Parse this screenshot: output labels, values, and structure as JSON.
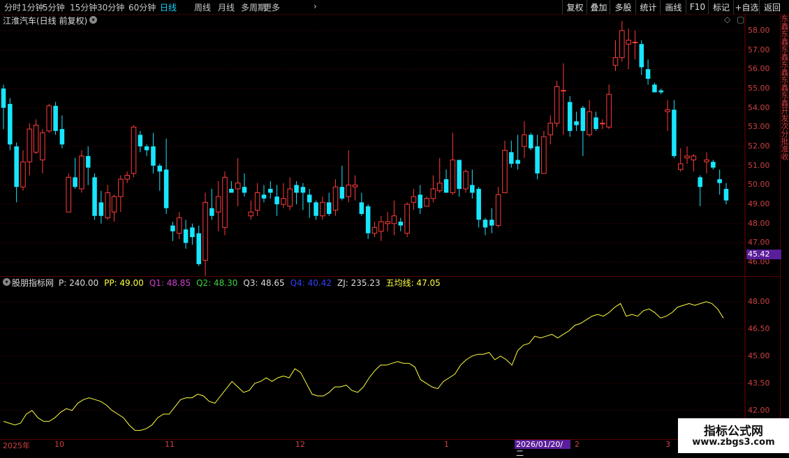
{
  "toolbar": {
    "left": [
      "分时",
      "1分钟",
      "5分钟",
      "15分钟",
      "30分钟",
      "60分钟",
      "日线",
      "周线",
      "月线",
      "多周期",
      "更多"
    ],
    "active": "日线",
    "right": [
      "复权",
      "叠加",
      "多股",
      "统计",
      "画线",
      "F10",
      "标记",
      "+自选",
      "返回"
    ]
  },
  "title": {
    "stock": "江淮汽车(日线 前复权)"
  },
  "main_axis": {
    "labels": [
      "58.00",
      "57.00",
      "56.00",
      "55.00",
      "54.00",
      "53.00",
      "52.00",
      "51.00",
      "50.00",
      "49.00",
      "48.00",
      "47.00",
      "46.00"
    ],
    "current_price": "45.42"
  },
  "indicator": {
    "name": "股朋指标网",
    "items": [
      {
        "label": "P: 240.00",
        "color": "#dcdcdc"
      },
      {
        "label": "PP: 49.00",
        "color": "#ffff40"
      },
      {
        "label": "Q1: 48.85",
        "color": "#d040d0"
      },
      {
        "label": "Q2: 48.30",
        "color": "#40d040"
      },
      {
        "label": "Q3: 48.65",
        "color": "#dcdcdc"
      },
      {
        "label": "Q4: 40.42",
        "color": "#3040ff"
      },
      {
        "label": "ZJ: 235.23",
        "color": "#dcdcdc"
      },
      {
        "label": "五均线: 47.05",
        "color": "#ffff40"
      }
    ],
    "axis": [
      "48.00",
      "46.50",
      "45.00",
      "43.50",
      "42.00"
    ]
  },
  "dates": {
    "labels": [
      "2025年",
      "10",
      "11",
      "12",
      "1",
      "2",
      "3"
    ],
    "highlight": "2026/01/20/二"
  },
  "watermark": {
    "line1": "指标公式网",
    "line2": "www.zbgs3.com"
  },
  "side_text": "东鑫东鑫东鑫东鑫东鑫东鑫开发次分批准收",
  "chart_data": [
    {
      "type": "candlestick",
      "title": "江淮汽车(日线 前复权)",
      "ylim": [
        45.5,
        58.5
      ],
      "up_color": "#ff3c3c",
      "down_color": "#18e6ff",
      "series": [
        {
          "o": 55.0,
          "c": 54.0,
          "h": 55.2,
          "l": 52.9
        },
        {
          "o": 54.2,
          "c": 52.1,
          "h": 54.5,
          "l": 51.8
        },
        {
          "o": 52.0,
          "c": 49.9,
          "h": 52.2,
          "l": 49.1
        },
        {
          "o": 49.9,
          "c": 51.2,
          "h": 51.8,
          "l": 49.7
        },
        {
          "o": 51.2,
          "c": 52.9,
          "h": 53.2,
          "l": 50.5
        },
        {
          "o": 51.7,
          "c": 53.1,
          "h": 53.4,
          "l": 51.6
        },
        {
          "o": 51.3,
          "c": 52.7,
          "h": 52.9,
          "l": 50.6
        },
        {
          "o": 52.8,
          "c": 54.1,
          "h": 54.2,
          "l": 52.7
        },
        {
          "o": 54.1,
          "c": 52.8,
          "h": 54.3,
          "l": 52.6
        },
        {
          "o": 52.9,
          "c": 52.1,
          "h": 53.6,
          "l": 51.9
        },
        {
          "o": 48.6,
          "c": 50.4,
          "h": 50.6,
          "l": 48.6
        },
        {
          "o": 50.4,
          "c": 49.9,
          "h": 51.4,
          "l": 49.8
        },
        {
          "o": 49.8,
          "c": 51.5,
          "h": 51.8,
          "l": 49.6
        },
        {
          "o": 51.5,
          "c": 50.9,
          "h": 52.0,
          "l": 50.0
        },
        {
          "o": 50.4,
          "c": 48.4,
          "h": 50.6,
          "l": 48.2
        },
        {
          "o": 49.1,
          "c": 48.4,
          "h": 49.7,
          "l": 48.0
        },
        {
          "o": 48.3,
          "c": 49.6,
          "h": 50.0,
          "l": 48.2
        },
        {
          "o": 48.6,
          "c": 49.4,
          "h": 49.5,
          "l": 48.1
        },
        {
          "o": 49.4,
          "c": 50.3,
          "h": 50.5,
          "l": 48.6
        },
        {
          "o": 50.3,
          "c": 50.5,
          "h": 50.7,
          "l": 50.1
        },
        {
          "o": 50.6,
          "c": 53.0,
          "h": 53.1,
          "l": 50.4
        },
        {
          "o": 52.6,
          "c": 52.0,
          "h": 52.8,
          "l": 51.7
        },
        {
          "o": 52.0,
          "c": 51.8,
          "h": 52.1,
          "l": 51.5
        },
        {
          "o": 52.0,
          "c": 51.0,
          "h": 52.7,
          "l": 50.6
        },
        {
          "o": 51.0,
          "c": 50.7,
          "h": 51.1,
          "l": 49.7
        },
        {
          "o": 50.8,
          "c": 48.8,
          "h": 52.4,
          "l": 48.5
        },
        {
          "o": 47.9,
          "c": 47.6,
          "h": 48.1,
          "l": 47.1
        },
        {
          "o": 47.5,
          "c": 48.3,
          "h": 48.6,
          "l": 47.2
        },
        {
          "o": 47.7,
          "c": 47.0,
          "h": 48.2,
          "l": 46.7
        },
        {
          "o": 47.8,
          "c": 47.3,
          "h": 48.0,
          "l": 46.9
        },
        {
          "o": 47.5,
          "c": 45.9,
          "h": 47.9,
          "l": 45.8
        },
        {
          "o": 46.1,
          "c": 49.1,
          "h": 49.6,
          "l": 45.3
        },
        {
          "o": 48.8,
          "c": 48.4,
          "h": 49.8,
          "l": 48.2
        },
        {
          "o": 48.6,
          "c": 49.4,
          "h": 50.2,
          "l": 47.6
        },
        {
          "o": 47.8,
          "c": 50.4,
          "h": 50.7,
          "l": 47.4
        },
        {
          "o": 49.8,
          "c": 49.6,
          "h": 50.2,
          "l": 49.6
        },
        {
          "o": 49.8,
          "c": 50.1,
          "h": 51.4,
          "l": 48.9
        },
        {
          "o": 49.9,
          "c": 49.6,
          "h": 50.6,
          "l": 49.4
        },
        {
          "o": 48.4,
          "c": 48.6,
          "h": 49.2,
          "l": 48.2
        },
        {
          "o": 48.7,
          "c": 49.6,
          "h": 50.1,
          "l": 48.4
        },
        {
          "o": 49.5,
          "c": 49.3,
          "h": 50.0,
          "l": 49.1
        },
        {
          "o": 49.8,
          "c": 49.6,
          "h": 50.2,
          "l": 49.3
        },
        {
          "o": 49.4,
          "c": 49.0,
          "h": 50.0,
          "l": 48.4
        },
        {
          "o": 49.0,
          "c": 49.3,
          "h": 50.1,
          "l": 48.8
        },
        {
          "o": 48.9,
          "c": 49.8,
          "h": 50.4,
          "l": 48.7
        },
        {
          "o": 50.0,
          "c": 49.6,
          "h": 50.2,
          "l": 49.0
        },
        {
          "o": 49.9,
          "c": 49.6,
          "h": 50.1,
          "l": 48.7
        },
        {
          "o": 49.5,
          "c": 49.1,
          "h": 49.8,
          "l": 48.3
        },
        {
          "o": 49.1,
          "c": 48.4,
          "h": 49.2,
          "l": 48.2
        },
        {
          "o": 48.4,
          "c": 49.1,
          "h": 49.4,
          "l": 48.2
        },
        {
          "o": 49.1,
          "c": 48.5,
          "h": 49.6,
          "l": 48.4
        },
        {
          "o": 48.7,
          "c": 49.9,
          "h": 50.3,
          "l": 48.4
        },
        {
          "o": 49.9,
          "c": 49.3,
          "h": 51.0,
          "l": 49.2
        },
        {
          "o": 49.4,
          "c": 50.0,
          "h": 51.8,
          "l": 49.1
        },
        {
          "o": 49.9,
          "c": 50.0,
          "h": 50.5,
          "l": 49.2
        },
        {
          "o": 49.1,
          "c": 48.5,
          "h": 49.6,
          "l": 48.4
        },
        {
          "o": 48.9,
          "c": 47.5,
          "h": 49.0,
          "l": 47.2
        },
        {
          "o": 47.5,
          "c": 47.8,
          "h": 48.1,
          "l": 47.3
        },
        {
          "o": 47.6,
          "c": 48.1,
          "h": 48.4,
          "l": 47.1
        },
        {
          "o": 48.0,
          "c": 48.1,
          "h": 48.6,
          "l": 47.6
        },
        {
          "o": 48.0,
          "c": 48.4,
          "h": 49.2,
          "l": 47.4
        },
        {
          "o": 48.1,
          "c": 47.9,
          "h": 48.3,
          "l": 47.6
        },
        {
          "o": 47.5,
          "c": 49.0,
          "h": 49.1,
          "l": 47.3
        },
        {
          "o": 49.1,
          "c": 49.4,
          "h": 49.8,
          "l": 48.7
        },
        {
          "o": 49.5,
          "c": 48.8,
          "h": 50.0,
          "l": 48.5
        },
        {
          "o": 48.9,
          "c": 49.3,
          "h": 49.4,
          "l": 48.9
        },
        {
          "o": 49.3,
          "c": 49.8,
          "h": 50.5,
          "l": 49.1
        },
        {
          "o": 49.7,
          "c": 50.1,
          "h": 51.4,
          "l": 49.6
        },
        {
          "o": 50.3,
          "c": 49.6,
          "h": 50.8,
          "l": 49.6
        },
        {
          "o": 49.6,
          "c": 51.3,
          "h": 52.7,
          "l": 49.5
        },
        {
          "o": 51.3,
          "c": 49.8,
          "h": 51.3,
          "l": 49.4
        },
        {
          "o": 49.8,
          "c": 50.7,
          "h": 50.8,
          "l": 49.6
        },
        {
          "o": 50.0,
          "c": 49.6,
          "h": 50.8,
          "l": 49.3
        },
        {
          "o": 49.8,
          "c": 48.2,
          "h": 49.9,
          "l": 47.8
        },
        {
          "o": 48.2,
          "c": 47.8,
          "h": 48.3,
          "l": 47.4
        },
        {
          "o": 48.2,
          "c": 47.9,
          "h": 48.8,
          "l": 47.5
        },
        {
          "o": 47.9,
          "c": 49.5,
          "h": 49.9,
          "l": 47.8
        },
        {
          "o": 49.6,
          "c": 51.8,
          "h": 52.3,
          "l": 49.6
        },
        {
          "o": 51.7,
          "c": 51.1,
          "h": 52.3,
          "l": 50.9
        },
        {
          "o": 51.3,
          "c": 51.1,
          "h": 52.6,
          "l": 50.8
        },
        {
          "o": 52.0,
          "c": 52.6,
          "h": 53.3,
          "l": 51.4
        },
        {
          "o": 52.6,
          "c": 51.9,
          "h": 52.7,
          "l": 51.8
        },
        {
          "o": 52.0,
          "c": 50.6,
          "h": 52.6,
          "l": 50.3
        },
        {
          "o": 50.6,
          "c": 52.5,
          "h": 52.8,
          "l": 50.6
        },
        {
          "o": 52.6,
          "c": 53.2,
          "h": 53.6,
          "l": 52.1
        },
        {
          "o": 53.2,
          "c": 55.1,
          "h": 55.4,
          "l": 53.0
        },
        {
          "o": 54.9,
          "c": 54.9,
          "h": 56.3,
          "l": 52.6
        },
        {
          "o": 54.3,
          "c": 52.8,
          "h": 54.6,
          "l": 52.5
        },
        {
          "o": 53.3,
          "c": 53.1,
          "h": 53.8,
          "l": 52.8
        },
        {
          "o": 54.0,
          "c": 52.8,
          "h": 54.1,
          "l": 51.5
        },
        {
          "o": 52.6,
          "c": 53.8,
          "h": 54.4,
          "l": 52.5
        },
        {
          "o": 53.5,
          "c": 52.9,
          "h": 53.8,
          "l": 52.8
        },
        {
          "o": 53.2,
          "c": 53.2,
          "h": 53.4,
          "l": 52.9
        },
        {
          "o": 53.0,
          "c": 54.7,
          "h": 55.2,
          "l": 52.9
        },
        {
          "o": 56.2,
          "c": 56.6,
          "h": 57.5,
          "l": 55.9
        },
        {
          "o": 56.6,
          "c": 58.0,
          "h": 58.5,
          "l": 56.4
        },
        {
          "o": 57.3,
          "c": 57.5,
          "h": 58.1,
          "l": 56.0
        },
        {
          "o": 57.4,
          "c": 57.4,
          "h": 58.0,
          "l": 56.5
        },
        {
          "o": 57.3,
          "c": 56.1,
          "h": 57.5,
          "l": 55.7
        },
        {
          "o": 56.0,
          "c": 55.5,
          "h": 56.5,
          "l": 55.2
        },
        {
          "o": 55.2,
          "c": 54.8,
          "h": 55.3,
          "l": 54.8
        },
        {
          "o": 54.9,
          "c": 54.8,
          "h": 55.0,
          "l": 54.7
        },
        {
          "o": 53.8,
          "c": 53.9,
          "h": 54.4,
          "l": 52.8
        },
        {
          "o": 53.9,
          "c": 51.5,
          "h": 54.4,
          "l": 51.4
        },
        {
          "o": 50.8,
          "c": 51.1,
          "h": 51.9,
          "l": 50.7
        },
        {
          "o": 51.4,
          "c": 51.5,
          "h": 52.0,
          "l": 51.1
        },
        {
          "o": 51.3,
          "c": 51.5,
          "h": 51.6,
          "l": 50.7
        },
        {
          "o": 50.4,
          "c": 49.9,
          "h": 50.5,
          "l": 48.9
        },
        {
          "o": 51.2,
          "c": 51.3,
          "h": 51.7,
          "l": 50.6
        },
        {
          "o": 51.2,
          "c": 50.9,
          "h": 51.3,
          "l": 50.8
        },
        {
          "o": 50.3,
          "c": 50.1,
          "h": 50.8,
          "l": 49.5
        },
        {
          "o": 49.8,
          "c": 49.2,
          "h": 50.1,
          "l": 49.0
        }
      ]
    },
    {
      "type": "line",
      "title": "股朋指标网",
      "ylim": [
        40.8,
        48.8
      ],
      "series": [
        {
          "name": "五均线",
          "color": "#ffff40",
          "values": [
            41.4,
            41.3,
            41.2,
            41.3,
            41.8,
            42.0,
            41.6,
            41.4,
            41.4,
            41.6,
            41.9,
            42.1,
            42.0,
            42.4,
            42.6,
            42.7,
            42.6,
            42.5,
            42.3,
            42.0,
            41.8,
            41.6,
            41.2,
            40.9,
            40.9,
            41.0,
            41.2,
            41.6,
            41.8,
            41.8,
            42.2,
            42.6,
            42.7,
            42.7,
            42.9,
            42.8,
            42.5,
            42.4,
            42.8,
            43.2,
            43.6,
            43.3,
            43.0,
            43.1,
            43.5,
            43.6,
            43.8,
            43.6,
            43.8,
            43.9,
            43.8,
            44.3,
            44.1,
            43.5,
            42.9,
            42.8,
            42.8,
            43.0,
            43.3,
            43.3,
            43.4,
            43.1,
            43.0,
            43.3,
            43.8,
            44.2,
            44.5,
            44.5,
            44.6,
            44.7,
            44.6,
            44.6,
            44.4,
            43.7,
            43.5,
            43.3,
            43.2,
            43.6,
            43.8,
            44.0,
            44.5,
            44.8,
            45.0,
            45.1,
            45.1,
            45.2,
            44.8,
            45.0,
            44.8,
            44.5,
            45.3,
            45.6,
            45.7,
            46.1,
            46.0,
            46.1,
            46.2,
            46.0,
            46.2,
            46.4,
            46.7,
            46.8,
            47.0,
            47.2,
            47.3,
            47.2,
            47.4,
            47.7,
            47.9,
            47.2,
            47.3,
            47.2,
            47.5,
            47.6,
            47.4,
            47.1,
            47.2,
            47.4,
            47.7,
            47.8,
            47.9,
            47.8,
            47.9,
            48.0,
            47.9,
            47.6,
            47.1
          ]
        }
      ],
      "axis_labels": [
        "48.00",
        "46.50",
        "45.00",
        "43.50",
        "42.00"
      ]
    }
  ]
}
